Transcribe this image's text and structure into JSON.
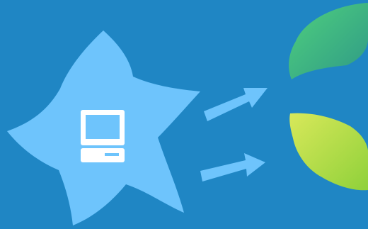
{
  "colors": {
    "background": "#1f86c4",
    "flower": "#6ec4fc",
    "arrow": "#6ec4fc",
    "computer": "#ffffff",
    "leaf_top_start": "#4fd07e",
    "leaf_top_end": "#2f9a86",
    "leaf_bottom_start": "#d8e85a",
    "leaf_bottom_end": "#8fd13a"
  },
  "icons": {
    "flower": "flower-shape",
    "computer": "computer-icon",
    "arrow_upper": "arrow-right-up",
    "arrow_lower": "arrow-right-up",
    "leaf_top": "green-leaf",
    "leaf_bottom": "lime-leaf"
  }
}
